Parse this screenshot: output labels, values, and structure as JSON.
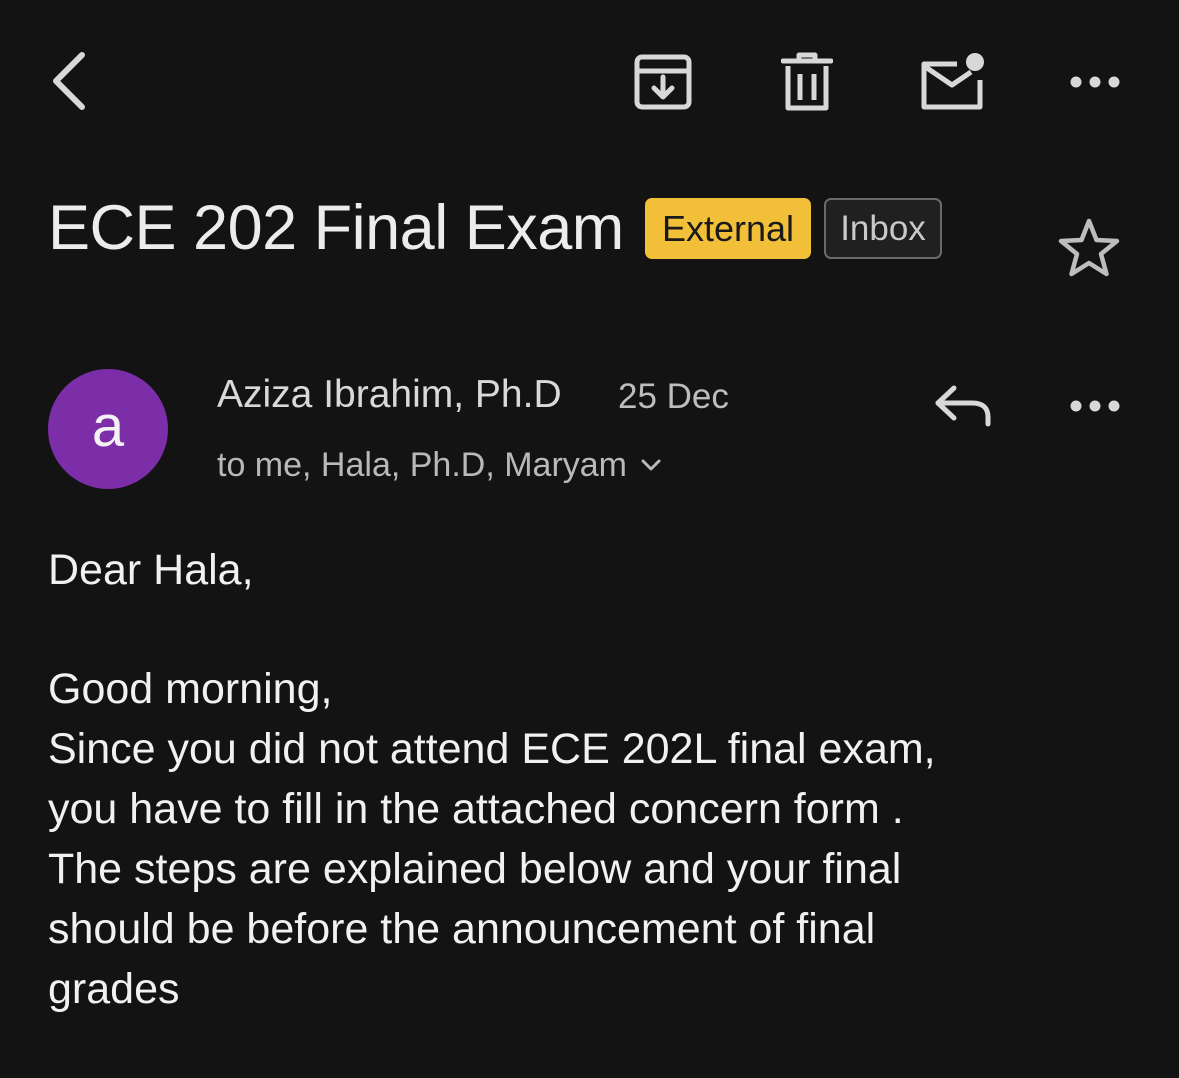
{
  "toolbar": {
    "back_icon": "chevron-left-icon",
    "archive_icon": "archive-icon",
    "delete_icon": "trash-icon",
    "mark_unread_icon": "mail-unread-icon",
    "more_icon": "more-horizontal-icon"
  },
  "message": {
    "subject": "ECE 202 Final Exam",
    "labels": {
      "external": "External",
      "inbox": "Inbox"
    },
    "star_icon": "star-outline-icon",
    "colors": {
      "external_label_bg": "#f2c038",
      "avatar_bg": "#7c2ea8",
      "background": "#131313"
    }
  },
  "sender": {
    "avatar_letter": "a",
    "name": "Aziza Ibrahim, Ph.D",
    "date": "25 Dec",
    "recipients": "to me, Hala, Ph.D, Maryam",
    "reply_icon": "reply-icon",
    "more_icon": "more-horizontal-icon"
  },
  "body": {
    "greeting": "Dear Hala,",
    "lines": [
      "Good morning,",
      "Since you did not attend ECE 202L final exam,",
      "you have to fill in the attached concern form .",
      "The steps are explained below and your final",
      "should be before the announcement of final",
      "grades"
    ]
  }
}
